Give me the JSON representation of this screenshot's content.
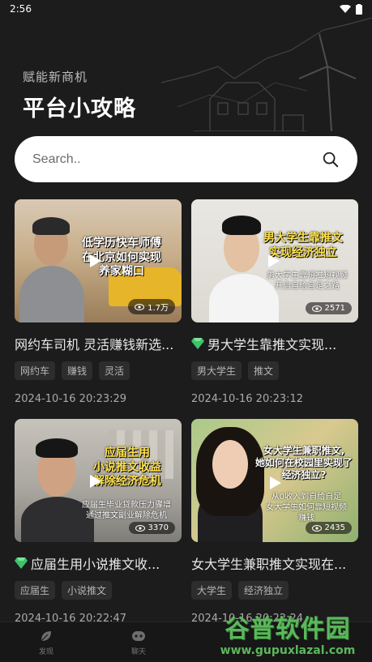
{
  "status": {
    "time": "2:56"
  },
  "header": {
    "subtitle": "赋能新商机",
    "title": "平台小攻略"
  },
  "search": {
    "placeholder": "Search.."
  },
  "cards": [
    {
      "thumb_title": "低学历快车师傅\n在北京如何实现\n养家糊口",
      "thumb_sub": "",
      "views": "1.7万",
      "title": "网约车司机 灵活赚钱新选...",
      "premium": false,
      "tags": [
        "网约车",
        "赚钱",
        "灵活"
      ],
      "date": "2024-10-16 20:23:29"
    },
    {
      "thumb_title": "男大学生靠推文\n实现经济独立",
      "thumb_sub": "男大学生靠短推短视频\n开启自给自足之路",
      "views": "2571",
      "title": "男大学生靠推文实现...",
      "premium": true,
      "tags": [
        "男大学生",
        "推文"
      ],
      "date": "2024-10-16 20:23:12"
    },
    {
      "thumb_title": "应届生用\n小说推文收益\n解除经济危机",
      "thumb_sub": "应届生毕业贷款压力骤增\n通过推文副业解除危机",
      "views": "3370",
      "title": "应届生用小说推文收...",
      "premium": true,
      "tags": [
        "应届生",
        "小说推文"
      ],
      "date": "2024-10-16 20:22:47"
    },
    {
      "thumb_title": "女大学生兼职推文,\n她如何在校园里实现了\n经济独立?",
      "thumb_sub": "从0收入到自给自足\n女大学生如何靠短视频\n赚钱",
      "views": "2435",
      "title": "女大学生兼职推文实现在...",
      "premium": false,
      "tags": [
        "大学生",
        "经济独立"
      ],
      "date": "2024-10-16 20:22:24"
    }
  ],
  "nav": [
    {
      "label": "发现",
      "icon": "leaf-icon"
    },
    {
      "label": "聊天",
      "icon": "chat-icon"
    }
  ],
  "watermark": {
    "big": "谷普软件园",
    "small": "www.gupuxlazal.com"
  },
  "colors": {
    "background": "#1c1c1c",
    "search_bg": "#ffffff",
    "thumb_text": "#ffffff",
    "gem": "#3ec36a",
    "watermark": "#5bb85b"
  }
}
